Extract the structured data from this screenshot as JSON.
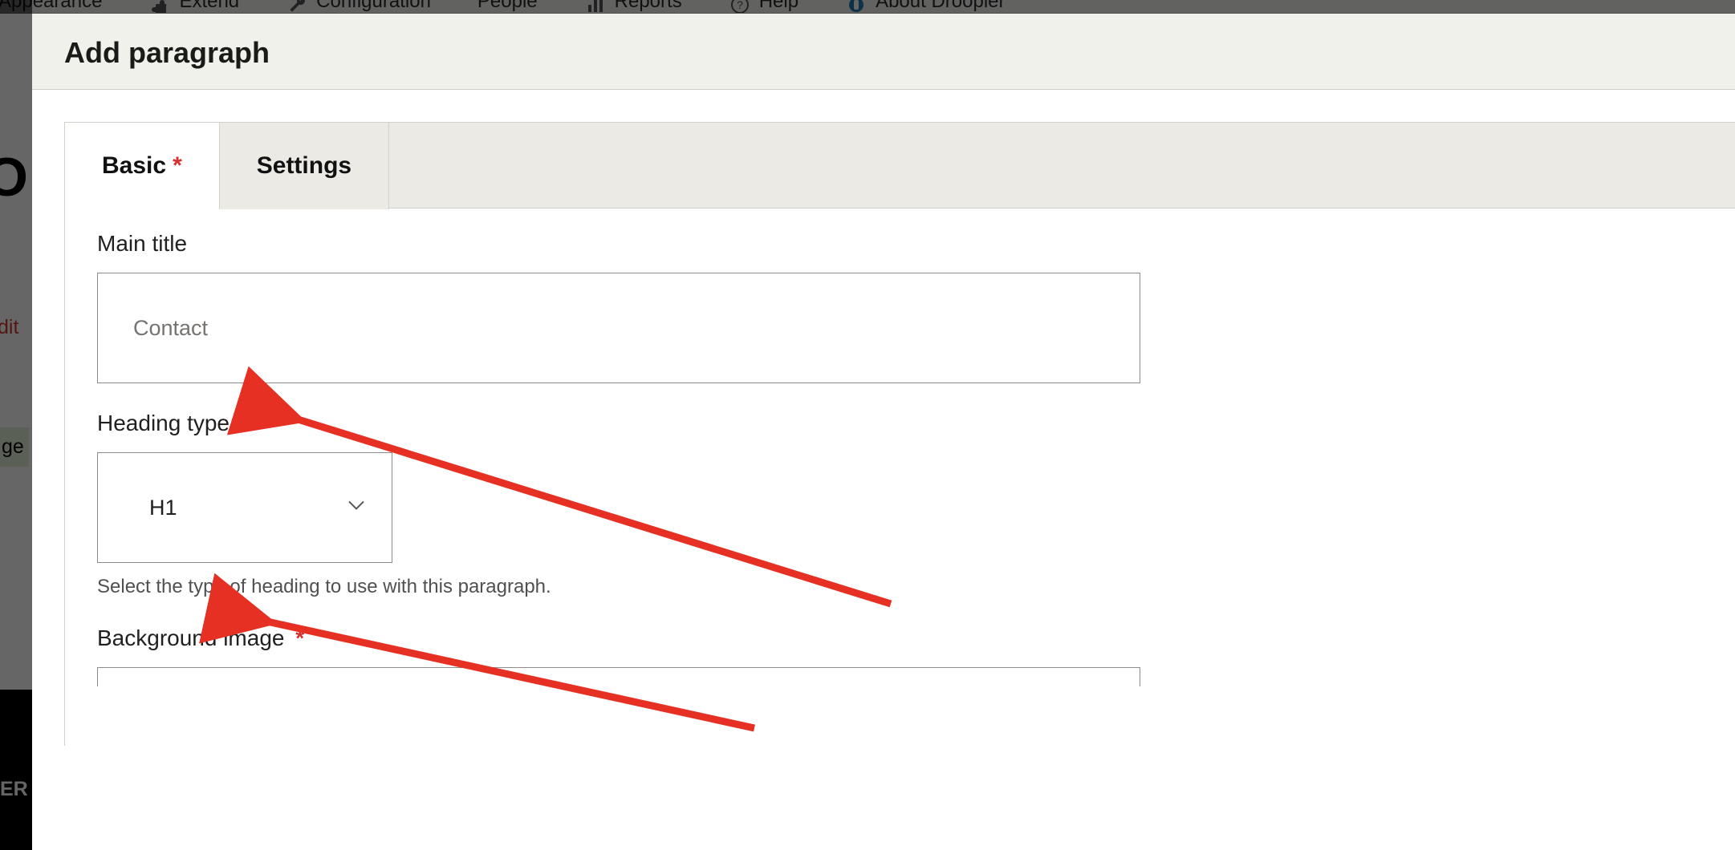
{
  "toolbar": {
    "items": [
      {
        "label": "Appearance"
      },
      {
        "label": "Extend"
      },
      {
        "label": "Configuration"
      },
      {
        "label": "People"
      },
      {
        "label": "Reports"
      },
      {
        "label": "Help"
      },
      {
        "label": "About Droopler"
      }
    ]
  },
  "underlying": {
    "char_o": "O",
    "edit_fragment": "dit",
    "badge_fragment": "ge",
    "footer_fragment": "ER"
  },
  "dialog": {
    "title": "Add paragraph"
  },
  "tabs": {
    "basic": {
      "label": "Basic",
      "required_marker": "*"
    },
    "settings": {
      "label": "Settings"
    }
  },
  "fields": {
    "main_title": {
      "label": "Main title",
      "value": "Contact"
    },
    "heading_type": {
      "label": "Heading type",
      "value": "H1",
      "description": "Select the type of heading to use with this paragraph."
    },
    "background_image": {
      "label": "Background image",
      "required_marker": "*"
    }
  },
  "colors": {
    "required": "#d3302f",
    "dialog_header_bg": "#f1f1eb",
    "tab_inactive_bg": "#eceae5",
    "input_border": "#8e8c88",
    "annotation": "#e63023"
  }
}
